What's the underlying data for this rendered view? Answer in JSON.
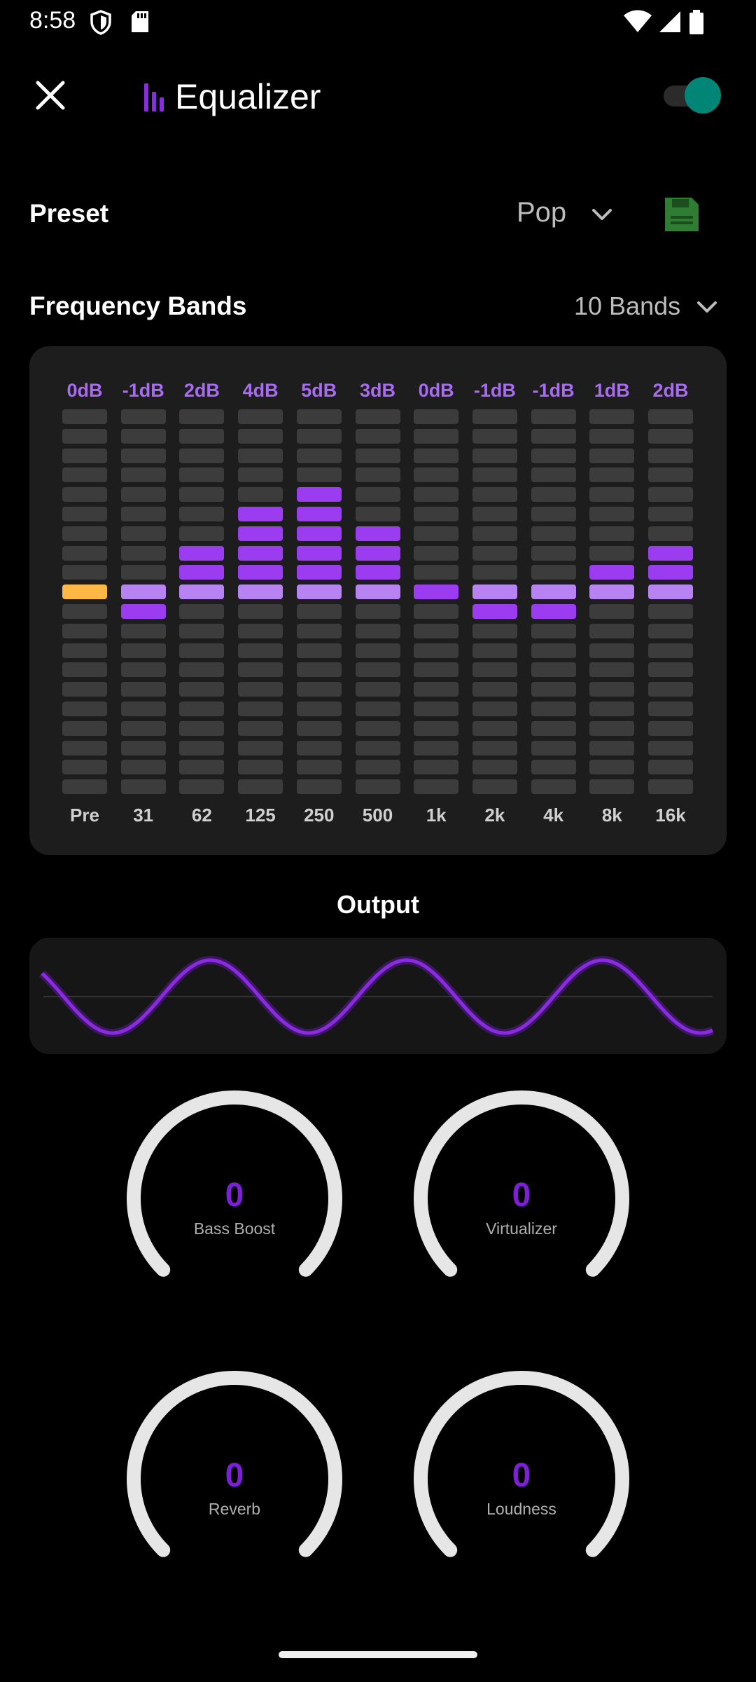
{
  "status_bar": {
    "time": "8:58"
  },
  "app_bar": {
    "title": "Equalizer",
    "enabled": true
  },
  "preset": {
    "label": "Preset",
    "value": "Pop"
  },
  "bands_selector": {
    "label": "Frequency Bands",
    "value": "10 Bands"
  },
  "eq": {
    "bands": [
      {
        "freq": "Pre",
        "db_label": "0dB",
        "db": 0
      },
      {
        "freq": "31",
        "db_label": "-1dB",
        "db": -1
      },
      {
        "freq": "62",
        "db_label": "2dB",
        "db": 2
      },
      {
        "freq": "125",
        "db_label": "4dB",
        "db": 4
      },
      {
        "freq": "250",
        "db_label": "5dB",
        "db": 5
      },
      {
        "freq": "500",
        "db_label": "3dB",
        "db": 3
      },
      {
        "freq": "1k",
        "db_label": "0dB",
        "db": 0
      },
      {
        "freq": "2k",
        "db_label": "-1dB",
        "db": -1
      },
      {
        "freq": "4k",
        "db_label": "-1dB",
        "db": -1
      },
      {
        "freq": "8k",
        "db_label": "1dB",
        "db": 1
      },
      {
        "freq": "16k",
        "db_label": "2dB",
        "db": 2
      }
    ]
  },
  "output": {
    "label": "Output"
  },
  "knobs": [
    {
      "label": "Bass Boost",
      "value": "0"
    },
    {
      "label": "Virtualizer",
      "value": "0"
    },
    {
      "label": "Reverb",
      "value": "0"
    },
    {
      "label": "Loudness",
      "value": "0"
    }
  ],
  "colors": {
    "accent": "#9b3cf0",
    "accent_light": "#b782f2",
    "preamp": "#ffb745",
    "toggle_on": "#008577",
    "save_icon": "#2e7d32"
  }
}
